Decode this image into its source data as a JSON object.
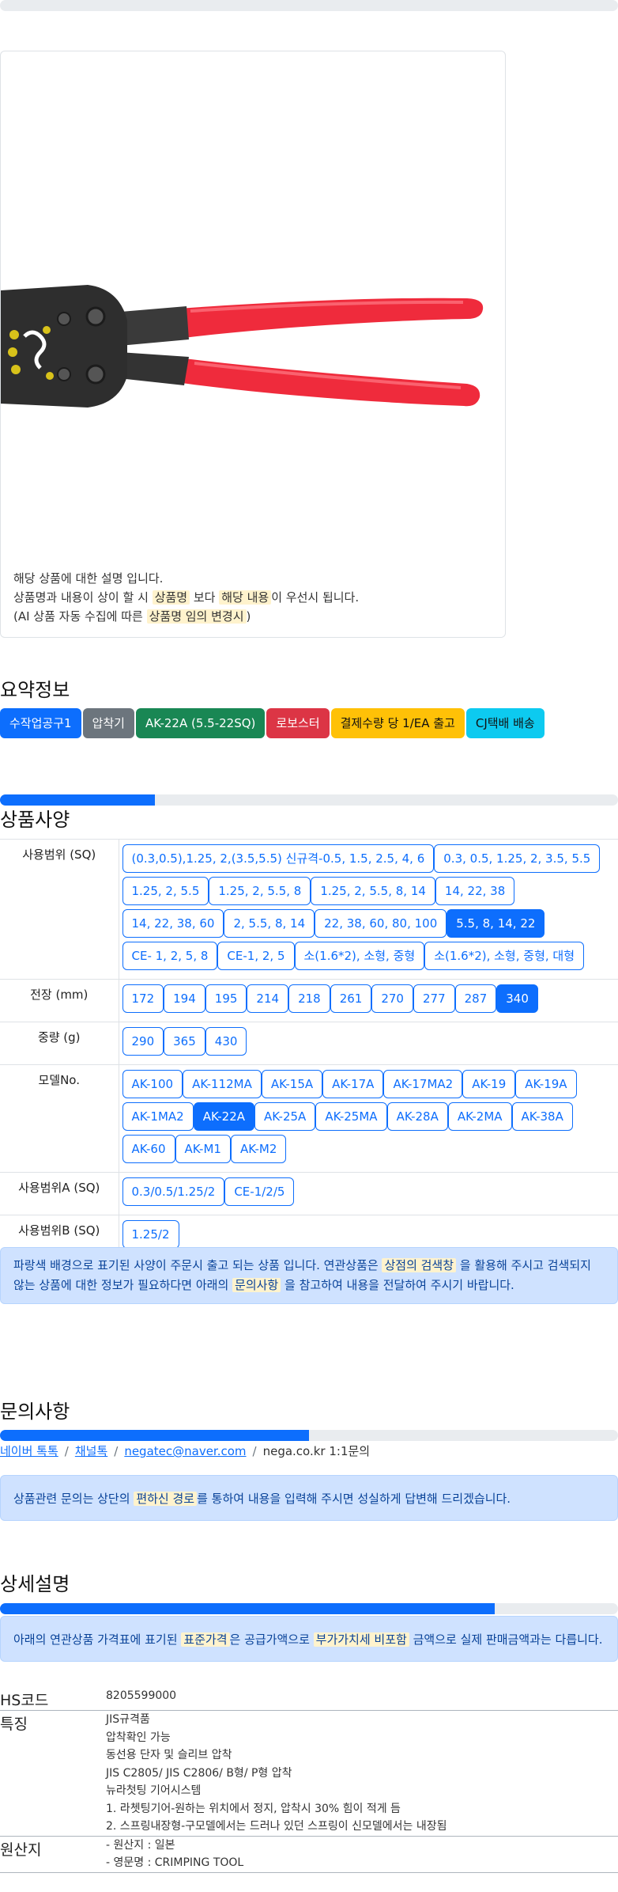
{
  "summary_note": {
    "line1": "해당 상품에 대한 설명 입니다.",
    "line2_a": "상품명과 내용이 상이 할 시",
    "line2_hl1": "상품명",
    "line2_b": "보다",
    "line2_hl2": "해당 내용",
    "line2_c": "이 우선시 됩니다.",
    "line3_a": "(AI 상품 자동 수집에 따른",
    "line3_hl": "상품명 임의 변경시",
    "line3_b": ")"
  },
  "summary": {
    "title": "요약정보",
    "badges": [
      {
        "label": "수작업공구1",
        "color": "#0d6efd"
      },
      {
        "label": "압착기",
        "color": "#6c757d"
      },
      {
        "label": "AK-22A (5.5-22SQ)",
        "color": "#198754"
      },
      {
        "label": "로보스터",
        "color": "#dc3545"
      },
      {
        "label": "결제수량 당 1/EA 출고",
        "color": "#ffc107"
      },
      {
        "label": "CJ택배 배송",
        "color": "#0dcaf0"
      }
    ]
  },
  "specs": {
    "title": "상품사양",
    "progress_percent": 25,
    "rows": [
      {
        "label": "사용범위 (SQ)",
        "options": [
          "(0.3,0.5),1.25, 2,(3.5,5.5) 신규격-0.5, 1.5, 2.5, 4, 6",
          "0.3, 0.5, 1.25, 2, 3.5, 5.5",
          "1.25, 2, 5.5",
          "1.25, 2, 5.5, 8",
          "1.25, 2, 5.5, 8, 14",
          "14, 22, 38",
          "14, 22, 38, 60",
          "2, 5.5, 8, 14",
          "22, 38, 60, 80, 100",
          "5.5, 8, 14, 22",
          "CE- 1, 2, 5, 8",
          "CE-1, 2, 5",
          "소(1.6*2), 소형, 중형",
          "소(1.6*2), 소형, 중형, 대형"
        ],
        "selected": "5.5, 8, 14, 22"
      },
      {
        "label": "전장 (mm)",
        "options": [
          "172",
          "194",
          "195",
          "214",
          "218",
          "261",
          "270",
          "277",
          "287",
          "340"
        ],
        "selected": "340"
      },
      {
        "label": "중량 (g)",
        "options": [
          "290",
          "365",
          "430"
        ],
        "selected": ""
      },
      {
        "label": "모델No.",
        "options": [
          "AK-100",
          "AK-112MA",
          "AK-15A",
          "AK-17A",
          "AK-17MA2",
          "AK-19",
          "AK-19A",
          "AK-1MA2",
          "AK-22A",
          "AK-25A",
          "AK-25MA",
          "AK-28A",
          "AK-2MA",
          "AK-38A",
          "AK-60",
          "AK-M1",
          "AK-M2"
        ],
        "selected": "AK-22A"
      },
      {
        "label": "사용범위A (SQ)",
        "options": [
          "0.3/0.5/1.25/2",
          "CE-1/2/5"
        ],
        "selected": ""
      },
      {
        "label": "사용범위B (SQ)",
        "options": [
          "1.25/2"
        ],
        "selected": ""
      }
    ],
    "notice_a": "파랑색 배경으로 표기된 사양이 주문시 출고 되는 상품 입니다. 연관상품은",
    "notice_hl1": "상점의 검색창",
    "notice_b": "을 활용해 주시고 검색되지 않는 상품에 대한 정보가 필요하다면 아래의",
    "notice_hl2": "문의사항",
    "notice_c": "을 참고하여 내용을 전달하여 주시기 바랍니다."
  },
  "inquiry": {
    "title": "문의사항",
    "progress_percent": 50,
    "links": [
      "네이버 톡톡",
      "채널톡",
      "negatec@naver.com"
    ],
    "last": "nega.co.kr 1:1문의",
    "notice_a": "상품관련 문의는 상단의",
    "notice_hl": "편하신 경로",
    "notice_b": "를 통하여 내용을 입력해 주시면 성실하게 답변해 드리겠습니다."
  },
  "detail": {
    "title": "상세설명",
    "progress_percent": 80,
    "notice_a": "아래의 연관상품 가격표에 표기된",
    "notice_hl1": "표준가격",
    "notice_b": "은 공급가액으로",
    "notice_hl2": "부가가치세 비포함",
    "notice_c": "금액으로 실제 판매금액과는 다릅니다.",
    "rows": [
      {
        "key": "HS코드",
        "lines": [
          "8205599000"
        ]
      },
      {
        "key": "특징",
        "lines": [
          "JIS규격품",
          "압착확인 가능",
          "동선용 단자 및 슬리브 압착",
          "JIS C2805/ JIS C2806/ B형/ P형 압착",
          "뉴라첫팅 기어시스템",
          "1. 라쳇팅기어-원하는 위치에서 정지, 압착시 30% 힘이 적게 듬",
          "2. 스프링내장형-구모델에서는 드러나 있던 스프링이 신모델에서는 내장됨"
        ]
      },
      {
        "key": "원산지",
        "lines": [
          "- 원산지 : 일본",
          "- 영문명 : CRIMPING TOOL"
        ]
      }
    ]
  }
}
